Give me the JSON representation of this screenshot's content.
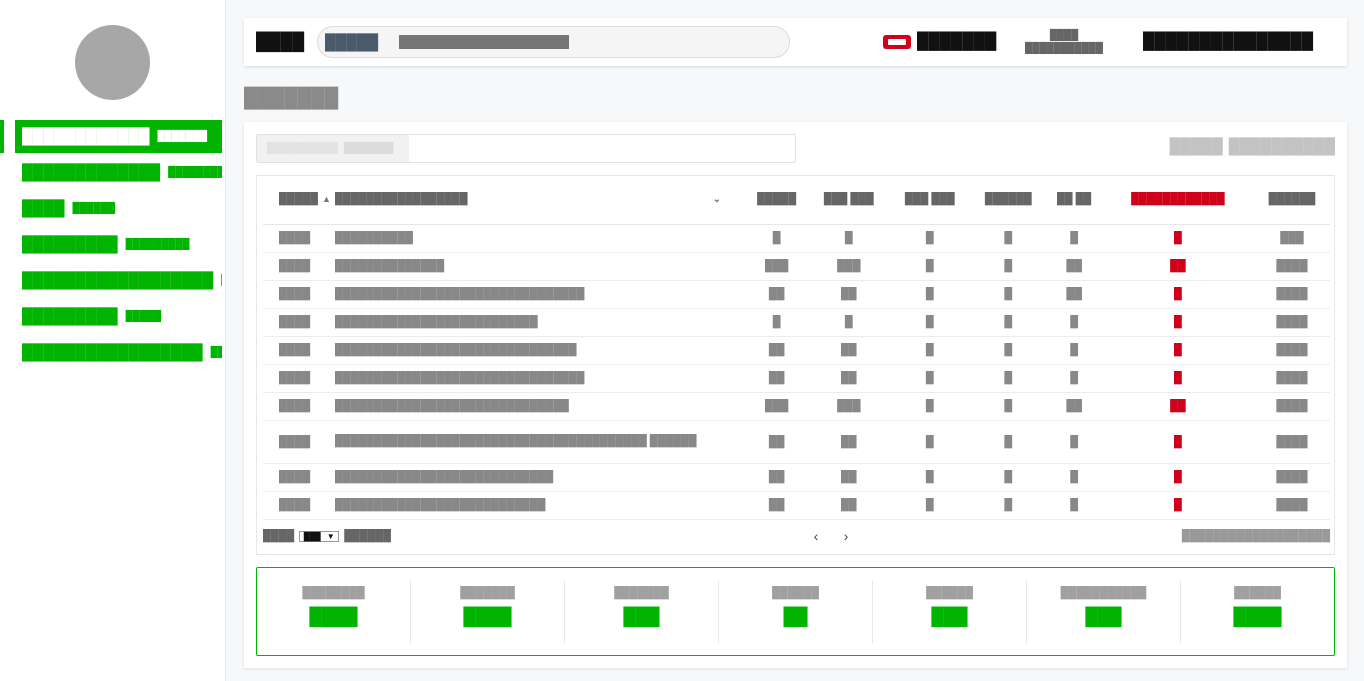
{
  "sidebar": {
    "items": [
      {
        "label": "████████████",
        "meta": "███████",
        "active": true
      },
      {
        "label": "█████████████",
        "meta": "██████████"
      },
      {
        "label": "████",
        "meta": "██████"
      },
      {
        "label": "█████████",
        "meta": "█████████"
      },
      {
        "label": "██████████████████",
        "meta": "█"
      },
      {
        "label": "█████████",
        "meta": "█████"
      },
      {
        "label": "█████████████████",
        "meta": "███"
      }
    ]
  },
  "topbar": {
    "brand": "████",
    "search_scope": "█████",
    "search_placeholder": "████████████████████",
    "alert_text": "███████",
    "user_line1": "████",
    "user_line2": "███████████",
    "org": "███████████████"
  },
  "page": {
    "title": "███████"
  },
  "filter": {
    "chip1": "██████████",
    "chip2": "███████"
  },
  "panel_actions": {
    "a": "█████",
    "b": "██████████"
  },
  "table": {
    "headers": [
      "█████",
      "█████████████████",
      "█████",
      "███ ███",
      "███ ███",
      "██████",
      "██ ██",
      "████████████",
      "██████"
    ],
    "rows": [
      [
        "████",
        "██████████",
        "█",
        "█",
        "█",
        "█",
        "█",
        "█",
        "███"
      ],
      [
        "████",
        "██████████████",
        "███",
        "███",
        "█",
        "█",
        "██",
        "██",
        "████"
      ],
      [
        "████",
        "████████████████████████████████",
        "██",
        "██",
        "█",
        "█",
        "██",
        "█",
        "████"
      ],
      [
        "████",
        "██████████████████████████",
        "█",
        "█",
        "█",
        "█",
        "█",
        "█",
        "████"
      ],
      [
        "████",
        "███████████████████████████████",
        "██",
        "██",
        "█",
        "█",
        "█",
        "█",
        "████"
      ],
      [
        "████",
        "████████████████████████████████",
        "██",
        "██",
        "█",
        "█",
        "█",
        "█",
        "████"
      ],
      [
        "████",
        "██████████████████████████████",
        "███",
        "███",
        "█",
        "█",
        "██",
        "██",
        "████"
      ],
      [
        "████",
        "████████████████████████████████████████ ██████",
        "██",
        "██",
        "█",
        "█",
        "█",
        "█",
        "████"
      ],
      [
        "████",
        "████████████████████████████",
        "██",
        "██",
        "█",
        "█",
        "█",
        "█",
        "████"
      ],
      [
        "████",
        "███████████████████████████",
        "██",
        "██",
        "█",
        "█",
        "█",
        "█",
        "████"
      ]
    ]
  },
  "pager": {
    "show": "████",
    "size": "███",
    "per": "██████",
    "info": "███████████████████"
  },
  "stats": [
    {
      "label": "████████",
      "value": "████"
    },
    {
      "label": "███████",
      "value": "████"
    },
    {
      "label": "███████",
      "value": "███"
    },
    {
      "label": "██████",
      "value": "██"
    },
    {
      "label": "██████",
      "value": "███"
    },
    {
      "label": "███████████",
      "value": "███"
    },
    {
      "label": "██████",
      "value": "████"
    }
  ],
  "colors": {
    "accent": "#00b400",
    "danger": "#d0021b",
    "avatar": "#a7a7a7"
  }
}
